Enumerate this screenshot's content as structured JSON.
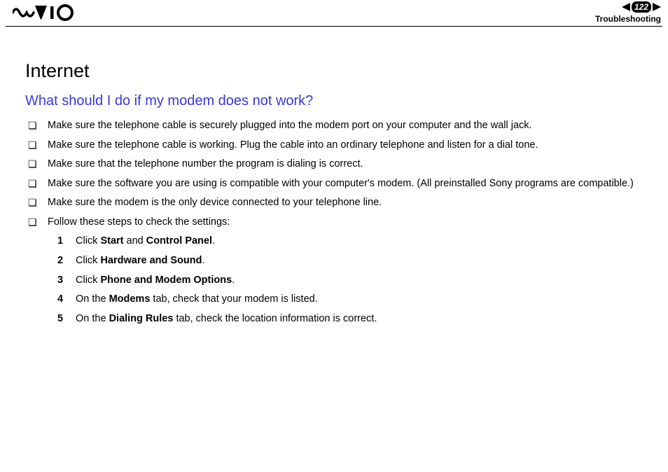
{
  "header": {
    "page_number": "122",
    "section_label": "Troubleshooting"
  },
  "content": {
    "main_heading": "Internet",
    "sub_heading": "What should I do if my modem does not work?",
    "bullets": [
      "Make sure the telephone cable is securely plugged into the modem port on your computer and the wall jack.",
      "Make sure the telephone cable is working. Plug the cable into an ordinary telephone and listen for a dial tone.",
      "Make sure that the telephone number the program is dialing is correct.",
      "Make sure the software you are using is compatible with your computer's modem. (All preinstalled Sony programs are compatible.)",
      "Make sure the modem is the only device connected to your telephone line.",
      "Follow these steps to check the settings:"
    ],
    "steps": [
      {
        "num": "1",
        "pre": "Click ",
        "bold1": "Start",
        "mid": " and ",
        "bold2": "Control Panel",
        "post": "."
      },
      {
        "num": "2",
        "pre": "Click ",
        "bold1": "Hardware and Sound",
        "mid": "",
        "bold2": "",
        "post": "."
      },
      {
        "num": "3",
        "pre": "Click ",
        "bold1": "Phone and Modem Options",
        "mid": "",
        "bold2": "",
        "post": "."
      },
      {
        "num": "4",
        "pre": "On the ",
        "bold1": "Modems",
        "mid": " tab, check that your modem is listed.",
        "bold2": "",
        "post": ""
      },
      {
        "num": "5",
        "pre": "On the ",
        "bold1": "Dialing Rules",
        "mid": " tab, check the location information is correct.",
        "bold2": "",
        "post": ""
      }
    ]
  }
}
